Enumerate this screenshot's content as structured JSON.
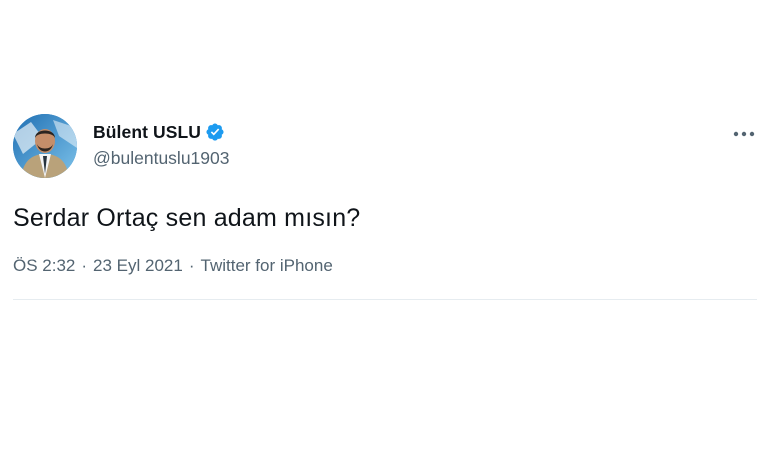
{
  "author": {
    "display_name": "Bülent USLU",
    "handle": "@bulentuslu1903",
    "verified": true,
    "verified_icon": "verified-badge-icon",
    "verified_color": "#1d9bf0"
  },
  "tweet": {
    "text": "Serdar Ortaç sen adam mısın?",
    "time": "ÖS 2:32",
    "separator": "·",
    "date": "23 Eyl 2021",
    "source": "Twitter for iPhone"
  },
  "more_icon": "more-horizontal-icon"
}
